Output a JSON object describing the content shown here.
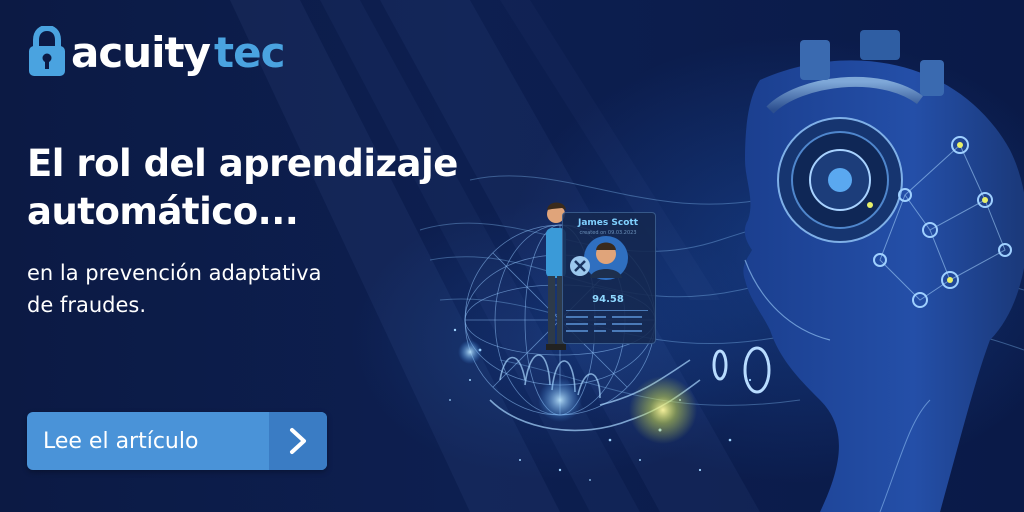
{
  "brand": {
    "name_part1": "acuity",
    "name_part2": "tec",
    "accent_color": "#4aa3e0",
    "logo_icon": "padlock-icon"
  },
  "headline": {
    "line1": "El rol del aprendizaje",
    "line2": "automático..."
  },
  "subheadline": {
    "line1": "en la prevención adaptativa",
    "line2": "de fraudes."
  },
  "cta": {
    "label": "Lee el artículo",
    "icon": "chevron-right-icon",
    "color": "#4a93d8"
  },
  "profile_card": {
    "name": "James Scott",
    "date": "created on 09.03.2023",
    "score": "94.58",
    "status_icon": "close-icon"
  }
}
